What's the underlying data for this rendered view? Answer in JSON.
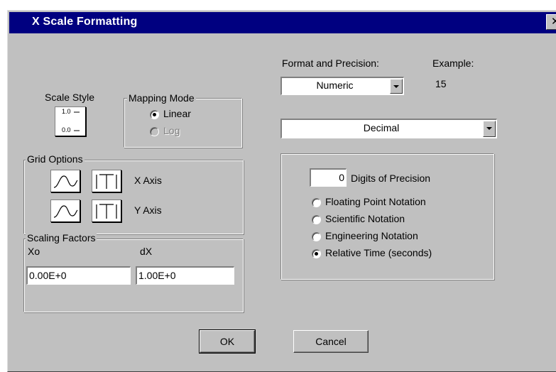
{
  "window": {
    "title": "X Scale Formatting",
    "close_glyph": "✕"
  },
  "scale_style": {
    "label": "Scale Style",
    "top_tick": "1.0",
    "bottom_tick": "0.0"
  },
  "mapping_mode": {
    "title": "Mapping Mode",
    "options": [
      {
        "label": "Linear",
        "checked": true,
        "enabled": true
      },
      {
        "label": "Log",
        "checked": false,
        "enabled": false
      }
    ]
  },
  "grid_options": {
    "title": "Grid Options",
    "rows": [
      {
        "label": "X Axis"
      },
      {
        "label": "Y Axis"
      }
    ],
    "icons": [
      "grid-wave-icon",
      "grid-tick-icon"
    ]
  },
  "scaling_factors": {
    "title": "Scaling Factors",
    "xo": {
      "label": "Xo",
      "value": "0.00E+0"
    },
    "dx": {
      "label": "dX",
      "value": "1.00E+0"
    }
  },
  "format": {
    "label": "Format and Precision:",
    "example_label": "Example:",
    "example_value": "15",
    "type_value": "Numeric",
    "style_value": "Decimal"
  },
  "precision": {
    "digits_value": "0",
    "digits_label": "Digits of Precision",
    "notations": [
      {
        "label": "Floating Point Notation",
        "checked": false
      },
      {
        "label": "Scientific Notation",
        "checked": false
      },
      {
        "label": "Engineering Notation",
        "checked": false
      },
      {
        "label": "Relative Time (seconds)",
        "checked": true
      }
    ]
  },
  "buttons": {
    "ok": "OK",
    "cancel": "Cancel"
  }
}
